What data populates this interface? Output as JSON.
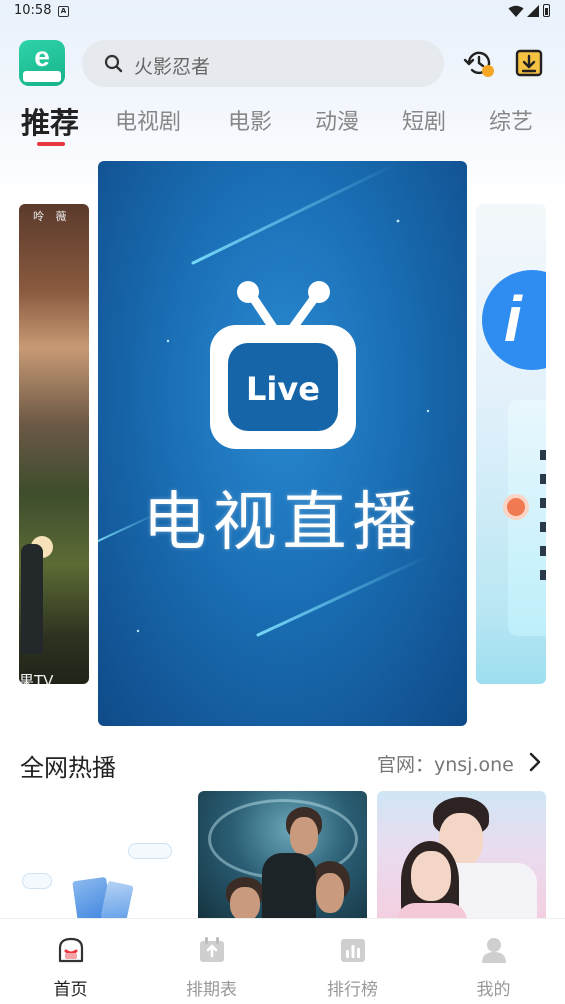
{
  "status_bar": {
    "time": "10:58",
    "notification_icon": "A"
  },
  "header": {
    "logo_icon": "app-logo-e",
    "search_placeholder": "火影忍者",
    "history_icon": "history-clock-icon",
    "download_icon": "download-icon"
  },
  "tabs": [
    {
      "label": "推荐",
      "active": true
    },
    {
      "label": "电视剧",
      "active": false
    },
    {
      "label": "电影",
      "active": false
    },
    {
      "label": "动漫",
      "active": false
    },
    {
      "label": "短剧",
      "active": false
    },
    {
      "label": "综艺",
      "active": false
    }
  ],
  "carousel": {
    "main": {
      "badge_text": "Live",
      "title": "电视直播"
    },
    "left_partial": {
      "top_text": "呤 薇",
      "brand_text": "果TV"
    }
  },
  "section": {
    "title": "全网热播",
    "official_site": "官网：ynsj.one"
  },
  "bottom_nav": [
    {
      "label": "首页",
      "icon": "home-icon",
      "active": true
    },
    {
      "label": "排期表",
      "icon": "schedule-icon",
      "active": false
    },
    {
      "label": "排行榜",
      "icon": "ranking-icon",
      "active": false
    },
    {
      "label": "我的",
      "icon": "profile-icon",
      "active": false
    }
  ],
  "colors": {
    "accent": "#e8373f",
    "banner_blue": "#1a6eb4",
    "logo_green": "#16b38a"
  }
}
